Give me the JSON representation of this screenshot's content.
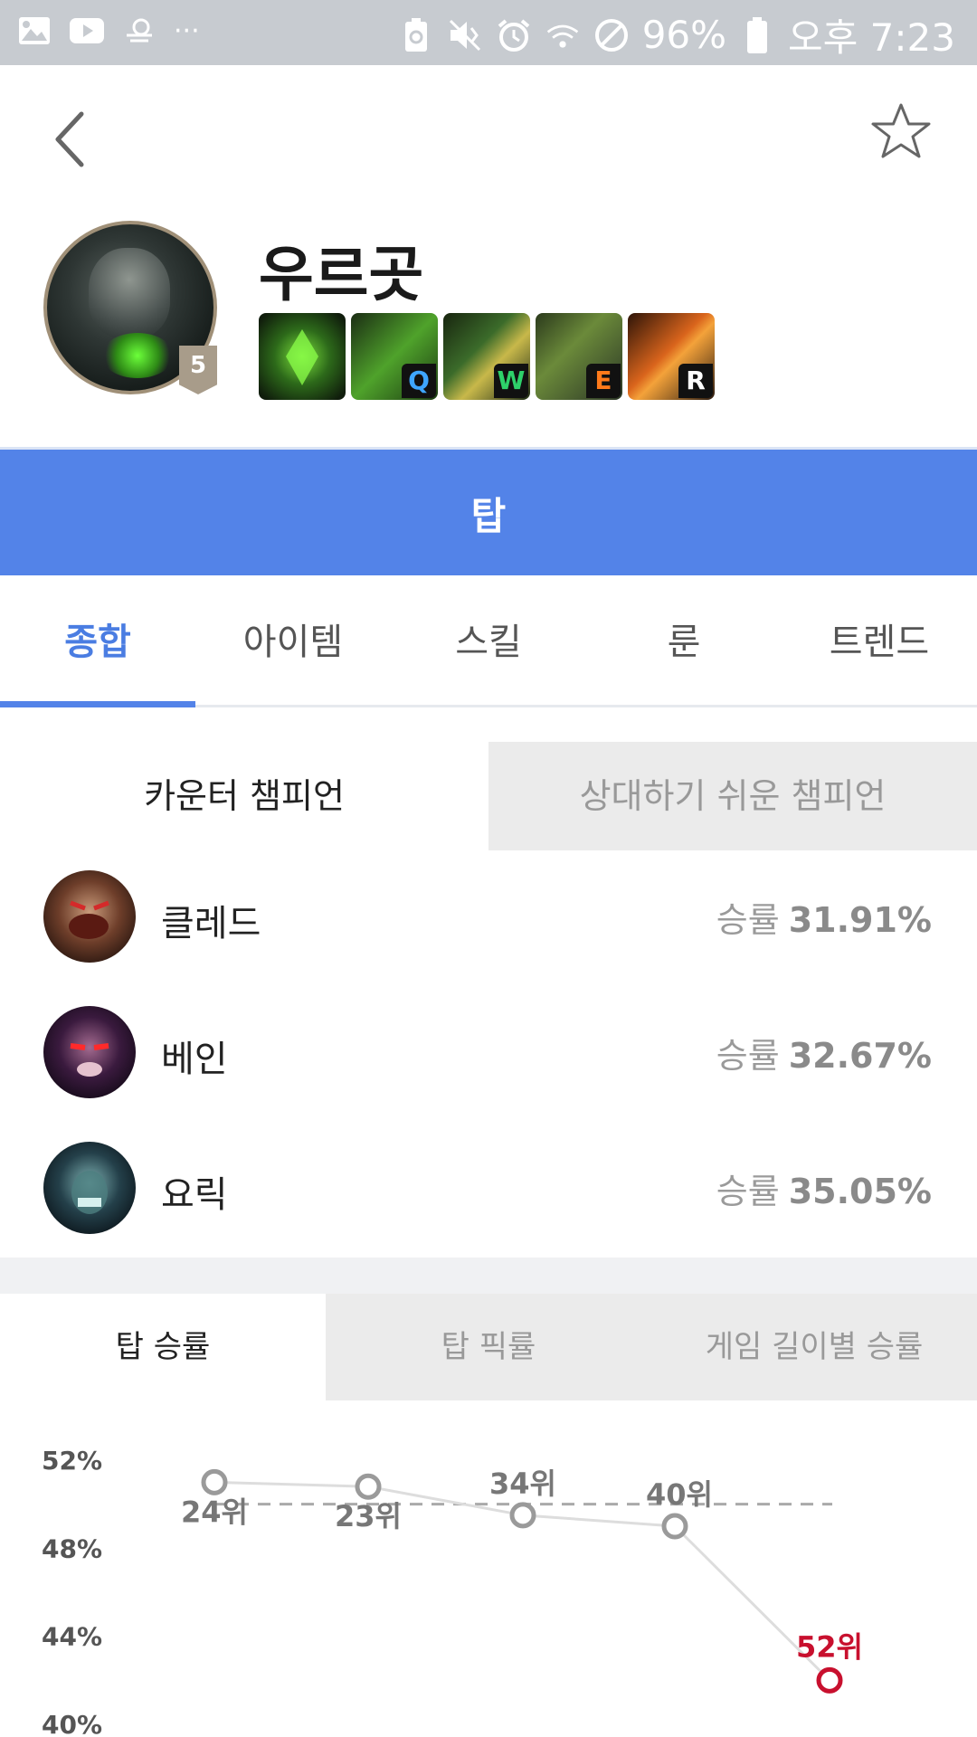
{
  "status_bar": {
    "icons_left": [
      "gallery-icon",
      "youtube-icon",
      "weather-icon",
      "more-icon"
    ],
    "more": "···",
    "icons_right": [
      "battery-saver-icon",
      "mute-vibrate-icon",
      "alarm-icon",
      "wifi-icon",
      "no-disturb-icon",
      "battery-icon"
    ],
    "battery": "96%",
    "time": "오후 7:23"
  },
  "header": {
    "champion_name": "우르곳",
    "level": "5",
    "skills": [
      {
        "key": "",
        "icon": "passive-icon"
      },
      {
        "key": "Q",
        "color": "#3ea6ff",
        "icon": "skill-q-icon"
      },
      {
        "key": "W",
        "color": "#2ed16a",
        "icon": "skill-w-icon"
      },
      {
        "key": "E",
        "color": "#ff7a1a",
        "icon": "skill-e-icon"
      },
      {
        "key": "R",
        "color": "#ffffff",
        "icon": "skill-r-icon"
      }
    ]
  },
  "role_bar": {
    "label": "탑",
    "color": "#5383e8"
  },
  "tabs": [
    "종합",
    "아이템",
    "스킬",
    "룬",
    "트렌드"
  ],
  "counter_tabs": {
    "active": "카운터 챔피언",
    "inactive": "상대하기 쉬운 챔피언"
  },
  "counters": [
    {
      "name": "클레드",
      "label": "승률",
      "value": "31.91%"
    },
    {
      "name": "베인",
      "label": "승률",
      "value": "32.67%"
    },
    {
      "name": "요릭",
      "label": "승률",
      "value": "35.05%"
    }
  ],
  "stat_tabs": [
    "탑 승률",
    "탑 픽률",
    "게임 길이별 승률"
  ],
  "chart_data": {
    "type": "line",
    "y_ticks": [
      "52%",
      "48%",
      "44%",
      "40%"
    ],
    "ylim": [
      40,
      52
    ],
    "reference_line": 50,
    "points": [
      {
        "value": 51.0,
        "rank": "24위"
      },
      {
        "value": 50.8,
        "rank": "23위"
      },
      {
        "value": 49.5,
        "rank": "34위"
      },
      {
        "value": 49.0,
        "rank": "40위"
      },
      {
        "value": 42.0,
        "rank": "52위",
        "highlight": true
      }
    ],
    "colors": {
      "line": "#dddddd",
      "marker": "#9a9a9a",
      "highlight": "#c8102e",
      "reference": "#aaaaaa"
    }
  }
}
